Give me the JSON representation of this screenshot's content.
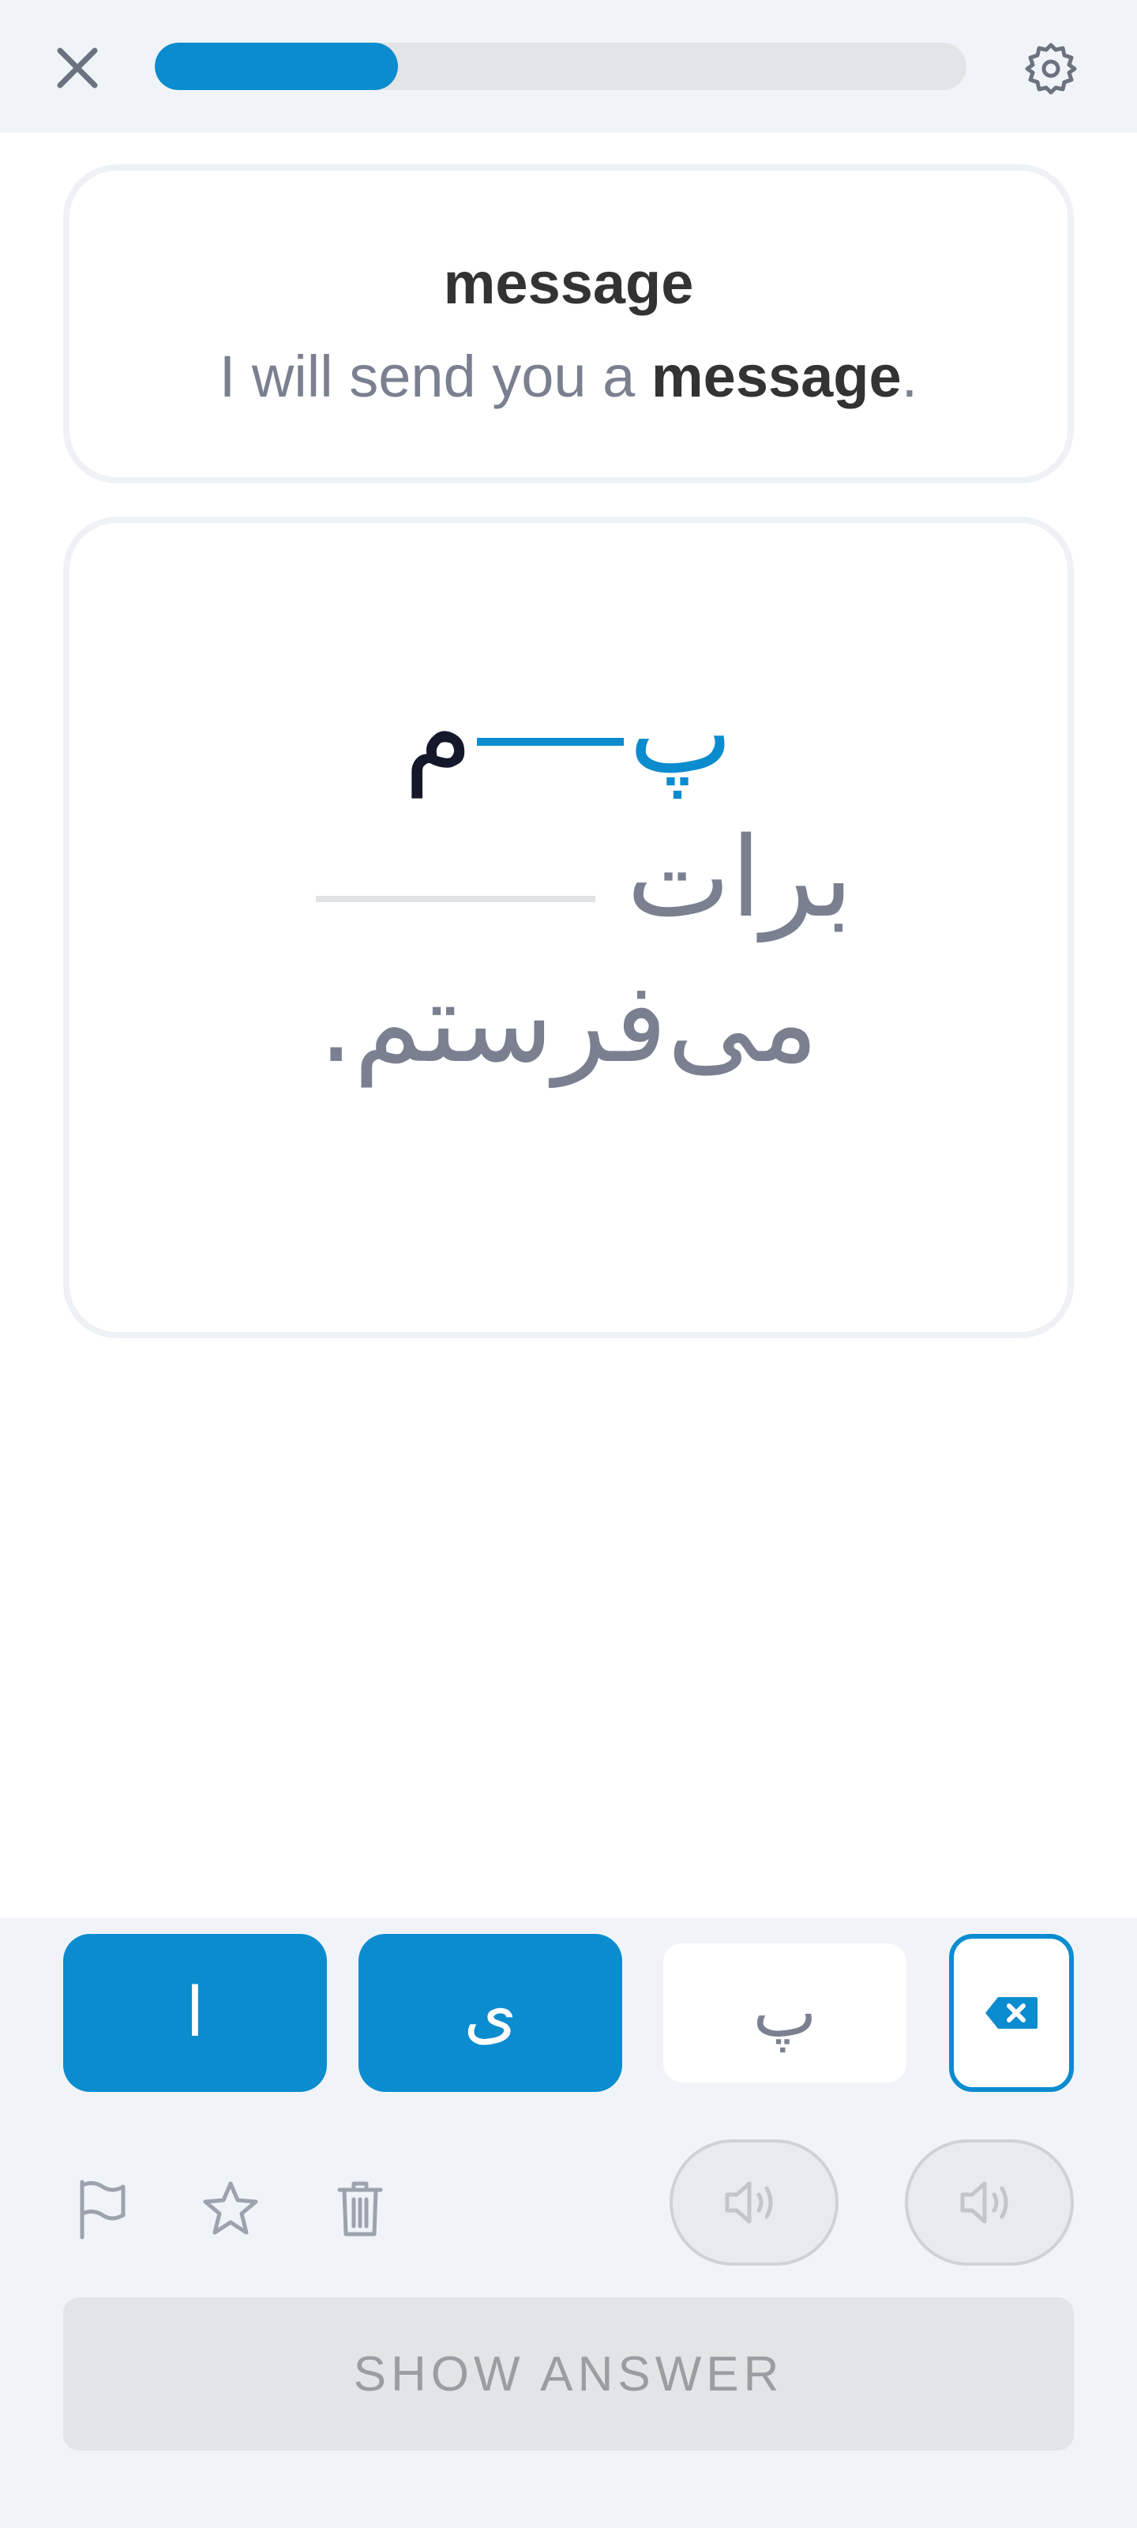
{
  "header": {
    "progress": 0.3,
    "close_icon": "close-icon",
    "settings_icon": "gear-icon",
    "accent_color": "#0a8ccf"
  },
  "prompt_card": {
    "word": "message",
    "sentence_pre": "I will send you a ",
    "sentence_highlight": "message",
    "sentence_post": "."
  },
  "answer_card": {
    "typed_first": "پ",
    "typed_last": "م",
    "sentence_word1": "برات",
    "sentence_line2": "می‌فرستم."
  },
  "keyboard": {
    "keys": [
      "ا",
      "ی",
      "پ"
    ],
    "backspace_icon": "backspace-icon"
  },
  "tools": {
    "flag_icon": "flag-icon",
    "star_icon": "star-icon",
    "trash_icon": "trash-icon",
    "audio_icon": "speaker-icon"
  },
  "show_answer_label": "SHOW ANSWER"
}
